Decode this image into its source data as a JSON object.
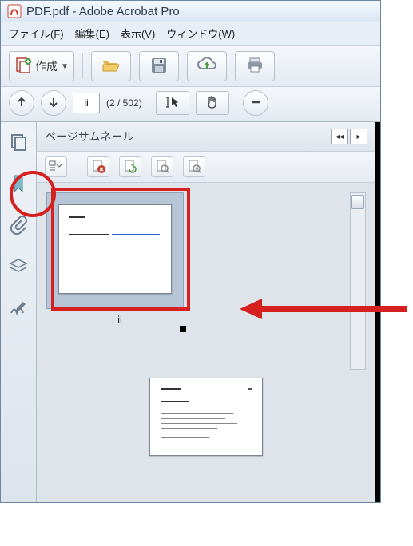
{
  "titlebar": {
    "title": "PDF.pdf - Adobe Acrobat Pro"
  },
  "menubar": {
    "file": "ファイル(F)",
    "edit": "編集(E)",
    "view": "表示(V)",
    "window": "ウィンドウ(W)"
  },
  "toolbar": {
    "create_label": "作成"
  },
  "pagenav": {
    "current": "ii",
    "count": "(2 / 502)"
  },
  "panel": {
    "title": "ページサムネール",
    "thumbnails": [
      {
        "label": "ii",
        "selected": true
      }
    ]
  }
}
